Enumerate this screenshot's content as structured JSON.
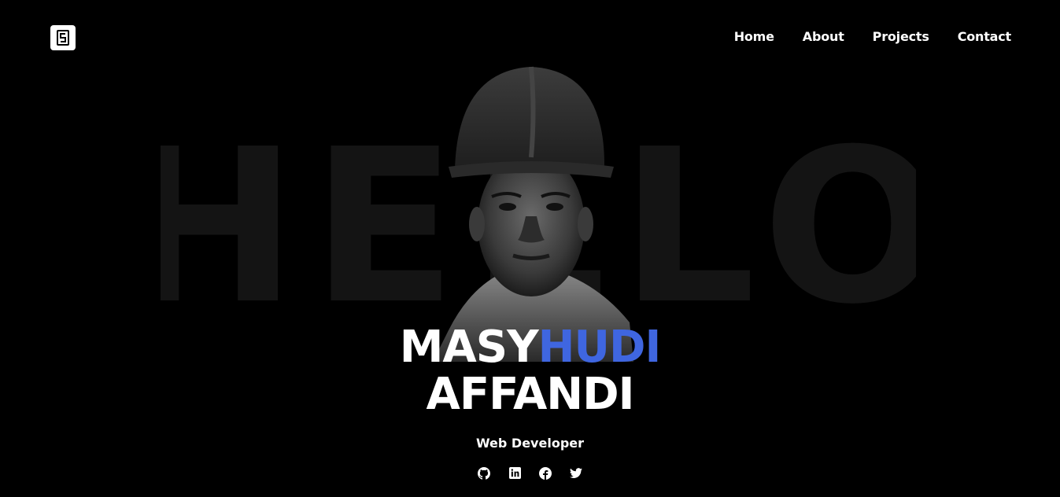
{
  "nav": {
    "logo_icon": "logo-icon",
    "links": [
      "Home",
      "About",
      "Projects",
      "Contact"
    ]
  },
  "hero": {
    "background_word": "HELLO",
    "name_first_plain": "MASY",
    "name_first_accent": "HUDI",
    "name_last": "AFFANDI",
    "role": "Web Developer",
    "accent_color": "#3f66e0"
  },
  "socials": [
    "github-icon",
    "linkedin-icon",
    "facebook-icon",
    "twitter-icon"
  ]
}
